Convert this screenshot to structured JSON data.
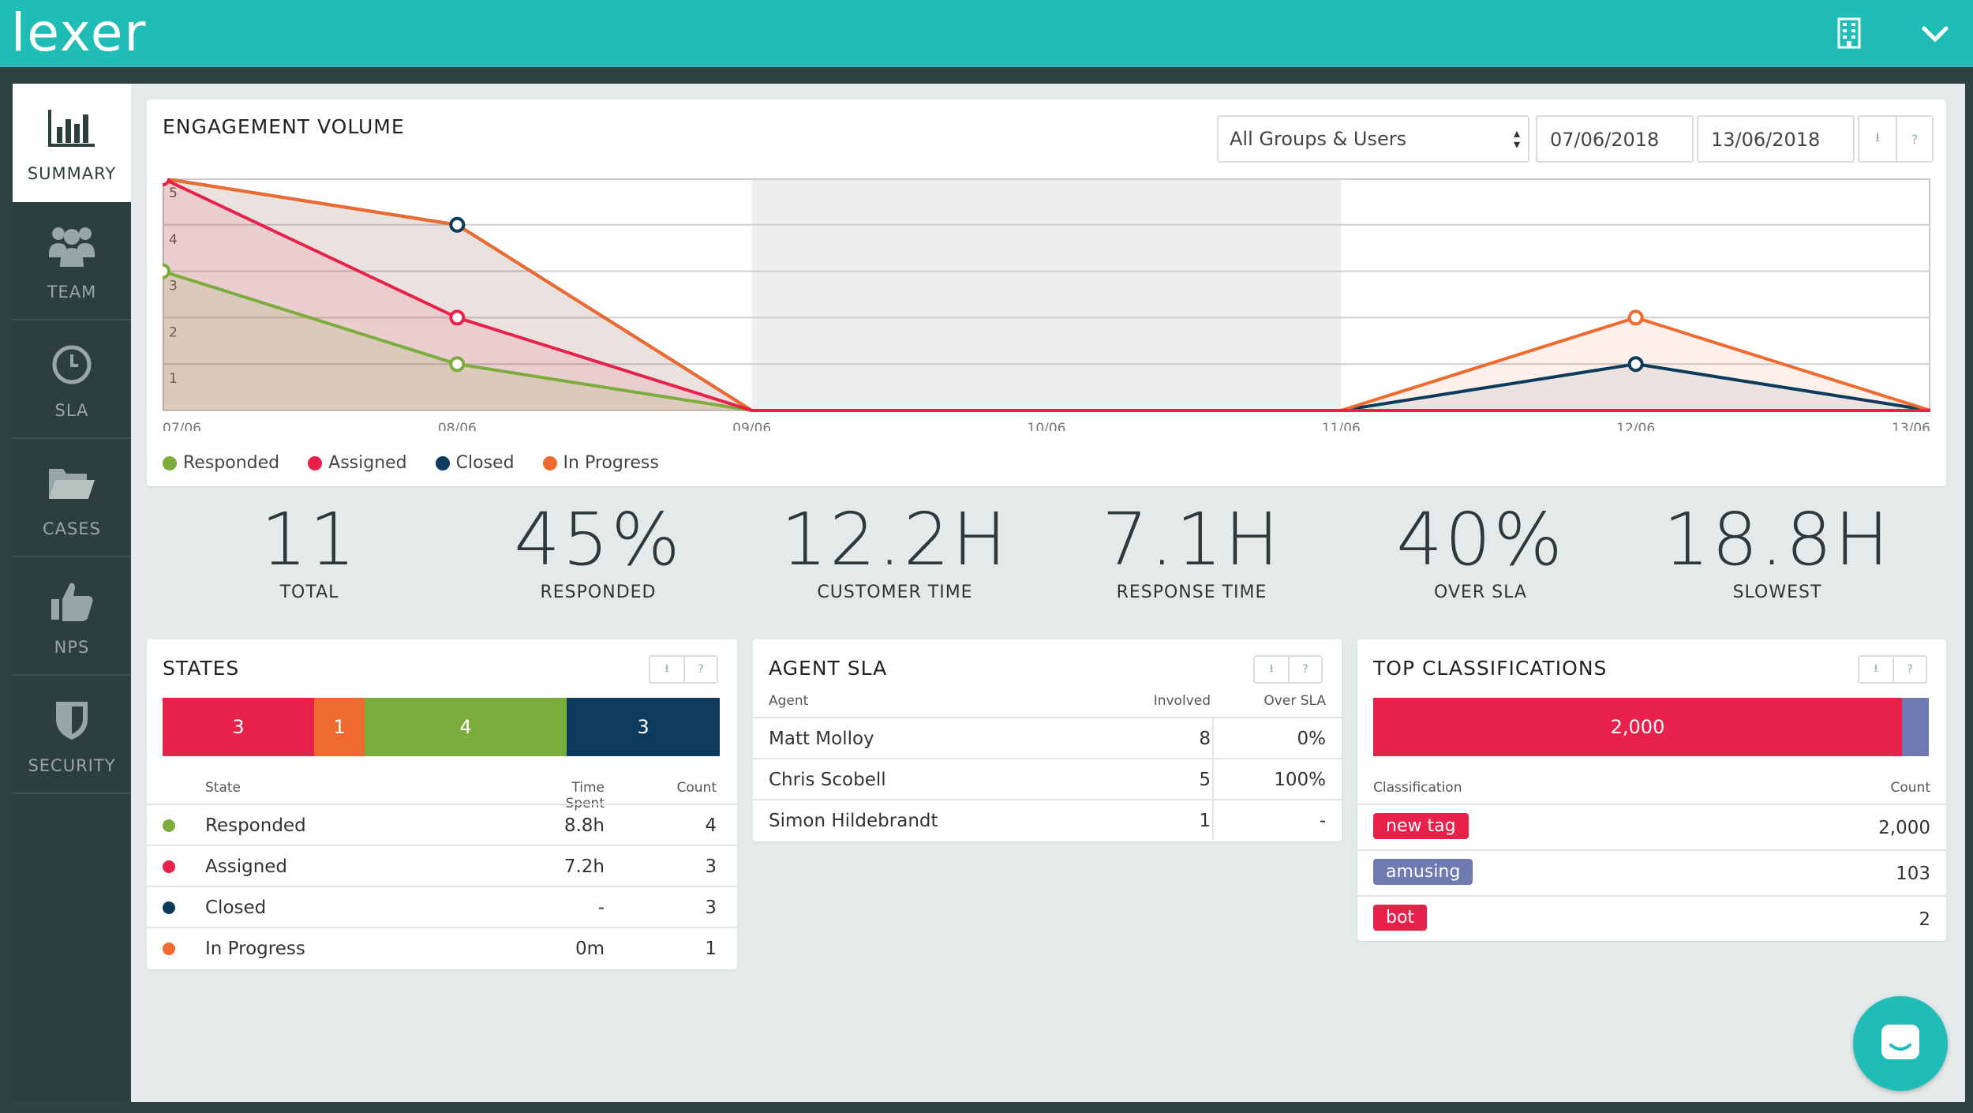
{
  "app": {
    "logo": "lexer"
  },
  "colors": {
    "responded": "#7cac3c",
    "assigned": "#e8214a",
    "closed": "#0c3b5e",
    "in_progress": "#ef6a2e",
    "accent": "#1fbdb5"
  },
  "sidebar": {
    "items": [
      {
        "label": "SUMMARY",
        "icon": "bar-chart-icon",
        "active": true
      },
      {
        "label": "TEAM",
        "icon": "team-icon"
      },
      {
        "label": "SLA",
        "icon": "clock-icon"
      },
      {
        "label": "CASES",
        "icon": "folder-icon"
      },
      {
        "label": "NPS",
        "icon": "thumbs-up-icon"
      },
      {
        "label": "SECURITY",
        "icon": "shield-icon"
      }
    ]
  },
  "engagement": {
    "title": "ENGAGEMENT VOLUME",
    "group_select": "All Groups & Users",
    "date_from": "07/06/2018",
    "date_to": "13/06/2018",
    "download_icon": "download-icon",
    "help_label": "?",
    "legend": [
      "Responded",
      "Assigned",
      "Closed",
      "In Progress"
    ]
  },
  "chart_data": {
    "type": "area",
    "categories": [
      "07/06",
      "08/06",
      "09/06",
      "10/06",
      "11/06",
      "12/06",
      "13/06"
    ],
    "y_ticks": [
      "1",
      "2",
      "3",
      "4",
      "5"
    ],
    "ylim": [
      0,
      5
    ],
    "grid": true,
    "legend_position": "bottom-left",
    "series": [
      {
        "name": "Responded",
        "values": [
          3,
          1,
          0,
          0,
          0,
          0,
          0
        ]
      },
      {
        "name": "Assigned",
        "values": [
          5,
          2,
          0,
          0,
          0,
          0,
          0
        ]
      },
      {
        "name": "Closed",
        "values": [
          5,
          4,
          0,
          0,
          0,
          1,
          0
        ]
      },
      {
        "name": "In Progress",
        "values": [
          5,
          4,
          0,
          0,
          0,
          2,
          0
        ]
      }
    ]
  },
  "stats": [
    {
      "value": "11",
      "label": "TOTAL"
    },
    {
      "value": "45%",
      "label": "RESPONDED"
    },
    {
      "value": "12.2H",
      "label": "CUSTOMER TIME"
    },
    {
      "value": "7.1H",
      "label": "RESPONSE TIME"
    },
    {
      "value": "40%",
      "label": "OVER SLA"
    },
    {
      "value": "18.8H",
      "label": "SLOWEST"
    }
  ],
  "states": {
    "title": "STATES",
    "bar": [
      "3",
      "1",
      "4",
      "3"
    ],
    "headers": {
      "state": "State",
      "time": "Time Spent",
      "count": "Count"
    },
    "rows": [
      {
        "state": "Responded",
        "time": "8.8h",
        "count": "4"
      },
      {
        "state": "Assigned",
        "time": "7.2h",
        "count": "3"
      },
      {
        "state": "Closed",
        "time": "-",
        "count": "3"
      },
      {
        "state": "In Progress",
        "time": "0m",
        "count": "1"
      }
    ]
  },
  "agent_sla": {
    "title": "AGENT SLA",
    "headers": {
      "agent": "Agent",
      "involved": "Involved",
      "over": "Over SLA"
    },
    "rows": [
      {
        "agent": "Matt Molloy",
        "involved": "8",
        "over": "0%"
      },
      {
        "agent": "Chris Scobell",
        "involved": "5",
        "over": "100%"
      },
      {
        "agent": "Simon Hildebrandt",
        "involved": "1",
        "over": "-"
      }
    ]
  },
  "classifications": {
    "title": "TOP CLASSIFICATIONS",
    "bar_label": "2,000",
    "headers": {
      "classification": "Classification",
      "count": "Count"
    },
    "rows": [
      {
        "tag": "new tag",
        "count": "2,000",
        "color": "#e8214a"
      },
      {
        "tag": "amusing",
        "count": "103",
        "color": "#6f7bb0"
      },
      {
        "tag": "bot",
        "count": "2",
        "color": "#e8214a"
      }
    ]
  }
}
